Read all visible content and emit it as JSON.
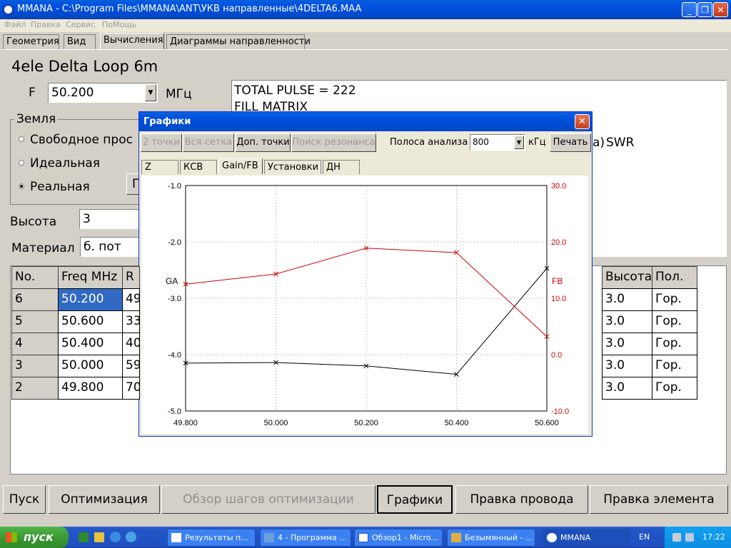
{
  "window": {
    "title": "MMANA - C:\\Program Files\\MMANA\\ANT\\УКВ направленные\\4DELTA6.MAA"
  },
  "menu": [
    "Файл",
    "Правка",
    "Сервис",
    "ПоМощь"
  ],
  "tabs": [
    "Геометрия",
    "Вид",
    "Вычисления",
    "Диаграммы направленности"
  ],
  "antenna_name": "4ele Delta Loop 6m",
  "freq": {
    "label": "F",
    "value": "50.200",
    "unit": "МГц"
  },
  "output_lines": [
    "TOTAL PULSE = 222",
    "FILL MATRIX"
  ],
  "output_right": {
    "partial": "a)",
    "swr": "SWR"
  },
  "ground": {
    "group_label": "Земля",
    "options": [
      {
        "label": "Свободное прос",
        "checked": false
      },
      {
        "label": "Идеальная",
        "checked": false
      },
      {
        "label": "Реальная",
        "checked": true
      }
    ],
    "param_button": "П"
  },
  "height": {
    "label": "Высота",
    "value": "3"
  },
  "material": {
    "label": "Материал",
    "value": "б. пот"
  },
  "table": {
    "headers": [
      "No.",
      "Freq MHz",
      "R",
      "Высота",
      "Пол."
    ],
    "rows": [
      {
        "no": "6",
        "freq": "50.200",
        "r": "49",
        "height": "3.0",
        "pol": "Гор.",
        "selected": true
      },
      {
        "no": "5",
        "freq": "50.600",
        "r": "33",
        "height": "3.0",
        "pol": "Гор.",
        "selected": false
      },
      {
        "no": "4",
        "freq": "50.400",
        "r": "40",
        "height": "3.0",
        "pol": "Гор.",
        "selected": false
      },
      {
        "no": "3",
        "freq": "50.000",
        "r": "59",
        "height": "3.0",
        "pol": "Гор.",
        "selected": false
      },
      {
        "no": "2",
        "freq": "49.800",
        "r": "70",
        "height": "3.0",
        "pol": "Гор.",
        "selected": false
      }
    ]
  },
  "bottom_buttons": {
    "start": "Пуск",
    "optimize": "Оптимизация",
    "review": "Обзор шагов оптимизации",
    "graphs": "Графики",
    "edit_wire": "Правка провода",
    "edit_element": "Правка элемента"
  },
  "dialog": {
    "title": "Графики",
    "buttons": {
      "two_points": "2 точки",
      "full_grid": "Вся сетка",
      "extra_points": "Доп. точки",
      "resonance": "Поиск резонанса",
      "print": "Печать"
    },
    "band_label": "Полоса анализа",
    "band_value": "800",
    "band_unit": "кГц",
    "tabs": [
      "Z",
      "КСВ",
      "Gain/FB",
      "Установки",
      "ДН"
    ],
    "active_tab": "Gain/FB"
  },
  "chart_data": {
    "type": "line",
    "x": [
      49.8,
      50.0,
      50.2,
      50.4,
      50.6
    ],
    "x_tick_labels": [
      "49.800",
      "50.000",
      "50.200",
      "50.400",
      "50.600"
    ],
    "left_axis": {
      "label": "GA",
      "ticks": [
        "-1.0",
        "-2.0",
        "-3.0",
        "-4.0",
        "-5.0"
      ],
      "range": [
        -5.0,
        -1.0
      ]
    },
    "right_axis": {
      "label": "FB",
      "ticks": [
        "30.0",
        "20.0",
        "10.0",
        "0.0",
        "-10.0"
      ],
      "range": [
        -10.0,
        30.0
      ]
    },
    "grid": true,
    "series": [
      {
        "name": "GA",
        "axis": "left",
        "color": "#000000",
        "values": [
          -4.15,
          -4.14,
          -4.2,
          -4.35,
          -2.47
        ]
      },
      {
        "name": "FB",
        "axis": "right",
        "color": "#d00000",
        "values": [
          12.5,
          14.3,
          18.9,
          18.1,
          3.2
        ]
      }
    ]
  },
  "taskbar": {
    "start": "пуск",
    "items": [
      "Результаты п...",
      "4 - Программа ...",
      "Обзор1 - Micro...",
      "Безымянный - ...",
      "MMANA"
    ],
    "lang": "EN",
    "clock": "17:22"
  },
  "colors": {
    "titlebar": "#0054e3",
    "taskbar": "#245edb",
    "start_button": "#3c9a35",
    "selected_cell": "#316ac5",
    "fb_series": "#d00000"
  }
}
